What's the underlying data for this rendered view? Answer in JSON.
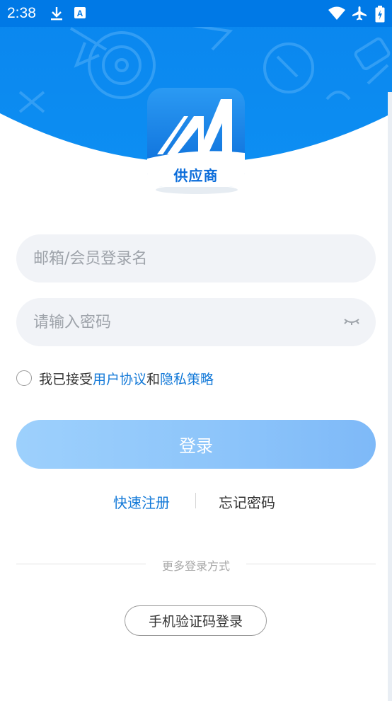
{
  "status_bar": {
    "time": "2:38",
    "icons": [
      "download-icon",
      "text-input-icon",
      "wifi-icon",
      "airplane-icon",
      "battery-charging-icon"
    ]
  },
  "colors": {
    "brand": "#1379D8",
    "header": "#0A86EE",
    "button": "#8CC4FA",
    "input_bg": "#F1F3F7"
  },
  "logo": {
    "label": "供应商"
  },
  "form": {
    "username": {
      "value": "",
      "placeholder": "邮箱/会员登录名"
    },
    "password": {
      "value": "",
      "placeholder": "请输入密码"
    }
  },
  "agreement": {
    "prefix": "我已接受",
    "user_agreement": "用户协议",
    "and": "和",
    "privacy_policy": "隐私策略",
    "checked": false
  },
  "login_button": "登录",
  "links": {
    "register": "快速注册",
    "forgot_password": "忘记密码"
  },
  "more_methods": "更多登录方式",
  "sms_login": "手机验证码登录"
}
